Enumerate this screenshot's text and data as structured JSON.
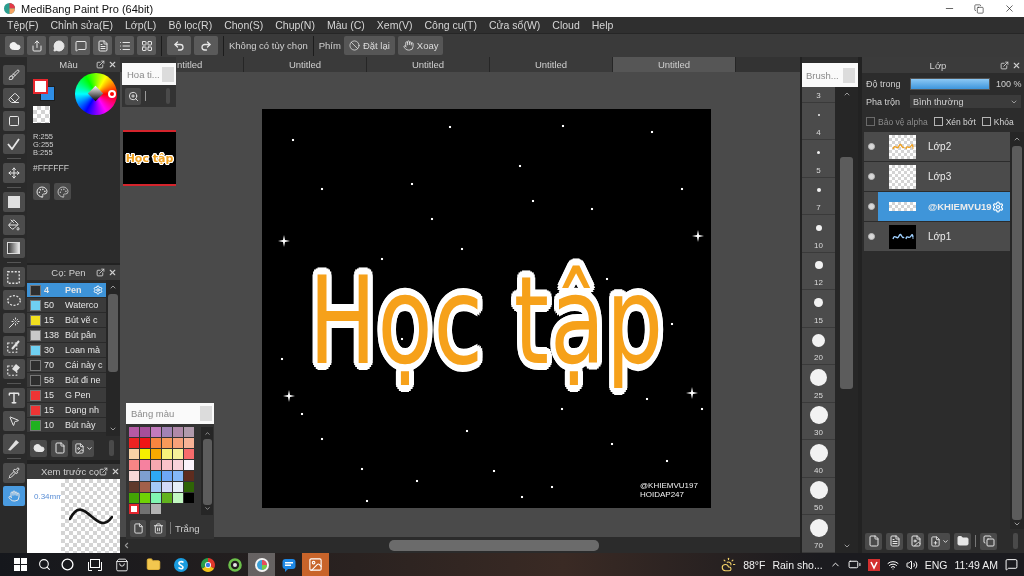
{
  "window": {
    "title": "MediBang Paint Pro (64bit)"
  },
  "menu": [
    "Tệp(F)",
    "Chỉnh sửa(E)",
    "Lớp(L)",
    "Bộ lọc(R)",
    "Chọn(S)",
    "Chụp(N)",
    "Màu (C)",
    "Xem(V)",
    "Công cụ(T)",
    "Cửa sổ(W)",
    "Cloud",
    "Help"
  ],
  "toolbar": {
    "option_text": "Không có tùy chọn",
    "key_label": "Phím",
    "buttons": [
      {
        "kind": "reset",
        "label": "Đặt lại"
      },
      {
        "kind": "rotate",
        "label": "Xoay"
      }
    ]
  },
  "tools": [
    [
      {
        "kind": "brush",
        "selected": false
      },
      {
        "kind": "eraser",
        "selected": false
      },
      {
        "kind": "dot",
        "selected": false
      },
      {
        "kind": "polyline",
        "selected": false
      }
    ],
    [
      {
        "kind": "move",
        "selected": false
      }
    ],
    [
      {
        "kind": "shape",
        "selected": false
      },
      {
        "kind": "bucket",
        "selected": false
      },
      {
        "kind": "gradient",
        "selected": false
      }
    ],
    [
      {
        "kind": "select-rect",
        "selected": false
      },
      {
        "kind": "lasso",
        "selected": false
      },
      {
        "kind": "wand",
        "selected": false
      },
      {
        "kind": "select-pen",
        "selected": false
      },
      {
        "kind": "select-eraser",
        "selected": false
      }
    ],
    [
      {
        "kind": "text",
        "selected": false
      },
      {
        "kind": "operation",
        "selected": false
      },
      {
        "kind": "divide",
        "selected": false
      }
    ],
    [
      {
        "kind": "eyedropper",
        "selected": false
      },
      {
        "kind": "hand",
        "selected": true
      }
    ]
  ],
  "color_panel": {
    "title": "Màu",
    "swatches": [
      {
        "color": "#ffffff",
        "selected": true
      },
      {
        "color": "#2f8ee6",
        "selected": false
      }
    ],
    "readout": [
      "R:255",
      "G:255",
      "B:255"
    ],
    "hex": "#FFFFFF"
  },
  "brush_panel": {
    "title": "Cọ: Pen",
    "brushes": [
      {
        "size": "4",
        "name": "Pen",
        "color": "#2e2e2e",
        "selected": true
      },
      {
        "size": "50",
        "name": "Waterco",
        "color": "#6fd0f2",
        "selected": false
      },
      {
        "size": "15",
        "name": "Bút vẽ c",
        "color": "#f2e01e",
        "selected": false
      },
      {
        "size": "138",
        "name": "Bút pân",
        "color": "#c9c9c9",
        "selected": false
      },
      {
        "size": "30",
        "name": "Loan mà",
        "color": "#6fd0f2",
        "selected": false
      },
      {
        "size": "70",
        "name": "Cái này c",
        "color": "#2e2e2e",
        "selected": false
      },
      {
        "size": "58",
        "name": "Bút đi ne",
        "color": "#2e2e2e",
        "selected": false
      },
      {
        "size": "15",
        "name": "G Pen",
        "color": "#ee3434",
        "selected": false
      },
      {
        "size": "15",
        "name": "Dạng nh",
        "color": "#ee3434",
        "selected": false
      },
      {
        "size": "10",
        "name": "Bút này",
        "color": "#1fb21f",
        "selected": false
      }
    ]
  },
  "brush_preview": {
    "title": "Xem trước cọ",
    "size": "0.34mm"
  },
  "canvas_tabs": [
    {
      "label": "ntitled",
      "selected": false
    },
    {
      "label": "Untitled",
      "selected": false
    },
    {
      "label": "Untitled",
      "selected": false
    },
    {
      "label": "Untitled",
      "selected": false
    },
    {
      "label": "Untitled",
      "selected": true
    }
  ],
  "navigator": {
    "title": "Hoa ti...",
    "zoom": {
      "level": 0
    },
    "thumbnail_text": "Học tập"
  },
  "artwork": {
    "lettering": "Học tập",
    "credit": [
      "@KHIEMVU197",
      "HOIDAP247"
    ]
  },
  "palette": {
    "title": "Bảng màu",
    "swatches": [
      {
        "color": "#b55aa5",
        "selected": false
      },
      {
        "color": "#a64f9a",
        "selected": false
      },
      {
        "color": "#c27bbd",
        "selected": false
      },
      {
        "color": "#a283b4",
        "selected": false
      },
      {
        "color": "#b089a9",
        "selected": false
      },
      {
        "color": "#b09aac",
        "selected": false
      },
      {
        "color": "#ee2323",
        "selected": false
      },
      {
        "color": "#f01515",
        "selected": false
      },
      {
        "color": "#f7853f",
        "selected": false
      },
      {
        "color": "#f89a5a",
        "selected": false
      },
      {
        "color": "#f8a27a",
        "selected": false
      },
      {
        "color": "#f8b296",
        "selected": false
      },
      {
        "color": "#f9d3a6",
        "selected": false
      },
      {
        "color": "#f5f000",
        "selected": false
      },
      {
        "color": "#f7a900",
        "selected": false
      },
      {
        "color": "#f8f27a",
        "selected": false
      },
      {
        "color": "#f7f19a",
        "selected": false
      },
      {
        "color": "#f76c6c",
        "selected": false
      },
      {
        "color": "#f88585",
        "selected": false
      },
      {
        "color": "#f6819f",
        "selected": false
      },
      {
        "color": "#f6a8b0",
        "selected": false
      },
      {
        "color": "#f9c3c9",
        "selected": false
      },
      {
        "color": "#f8d3da",
        "selected": false
      },
      {
        "color": "#faf2fa",
        "selected": false
      },
      {
        "color": "#f8dad8",
        "selected": false
      },
      {
        "color": "#7e9fd0",
        "selected": false
      },
      {
        "color": "#2ea9f4",
        "selected": false
      },
      {
        "color": "#6ea8f6",
        "selected": false
      },
      {
        "color": "#84b8f7",
        "selected": false
      },
      {
        "color": "#5e2c1e",
        "selected": false
      },
      {
        "color": "#5f392b",
        "selected": false
      },
      {
        "color": "#a3604a",
        "selected": false
      },
      {
        "color": "#a4caf7",
        "selected": false
      },
      {
        "color": "#d2d9f8",
        "selected": false
      },
      {
        "color": "#e6eff9",
        "selected": false
      },
      {
        "color": "#2f6406",
        "selected": false
      },
      {
        "color": "#43a304",
        "selected": false
      },
      {
        "color": "#6fd204",
        "selected": false
      },
      {
        "color": "#80f7b2",
        "selected": false
      },
      {
        "color": "#62b31f",
        "selected": false
      },
      {
        "color": "#c2f8c2",
        "selected": false
      },
      {
        "color": "#000000",
        "selected": false
      },
      {
        "color": "#ffffff",
        "selected": true
      },
      {
        "color": "#717171",
        "selected": false
      },
      {
        "color": "#b3b3b3",
        "selected": false
      }
    ],
    "current": "Trắng"
  },
  "brush_sizes": {
    "title": "Brush...",
    "sizes": [
      "3",
      "4",
      "5",
      "7",
      "10",
      "12",
      "15",
      "20",
      "25",
      "30",
      "40",
      "50",
      "70"
    ]
  },
  "layers_panel": {
    "title": "Lớp",
    "opacity": {
      "label": "Độ trong",
      "level": 1,
      "reading": "100 %"
    },
    "blend": {
      "label": "Pha trộn",
      "value": "Bình thường"
    },
    "options": [
      {
        "label": "Bảo vệ alpha",
        "checked": false,
        "disabled": true
      },
      {
        "label": "Xén bớt",
        "checked": false,
        "disabled": false
      },
      {
        "label": "Khóa",
        "checked": false,
        "disabled": false
      }
    ],
    "layers": [
      {
        "name": "Lớp2",
        "kind": "lettering",
        "visible": true,
        "selected": false
      },
      {
        "name": "Lớp3",
        "kind": "blank",
        "visible": true,
        "selected": false
      },
      {
        "name": "@KHIEMVU19",
        "kind": "strip",
        "visible": true,
        "selected": true
      },
      {
        "name": "Lớp1",
        "kind": "dark",
        "visible": true,
        "selected": false
      }
    ]
  },
  "taskbar": {
    "apps": [
      {
        "kind": "bag",
        "selected": false,
        "alert": false
      },
      {
        "kind": "folder",
        "selected": false,
        "alert": false
      },
      {
        "kind": "circle-wave",
        "selected": false,
        "alert": false
      },
      {
        "kind": "tricolor",
        "selected": false,
        "alert": false
      },
      {
        "kind": "ring",
        "selected": false,
        "alert": false
      },
      {
        "kind": "paint",
        "selected": true,
        "alert": false
      },
      {
        "kind": "chat",
        "selected": false,
        "alert": false
      },
      {
        "kind": "photo",
        "selected": false,
        "alert": true
      }
    ],
    "weather": {
      "temp": "88°F",
      "text": "Rain sho..."
    },
    "language": "ENG",
    "clock": "11:49 AM"
  }
}
